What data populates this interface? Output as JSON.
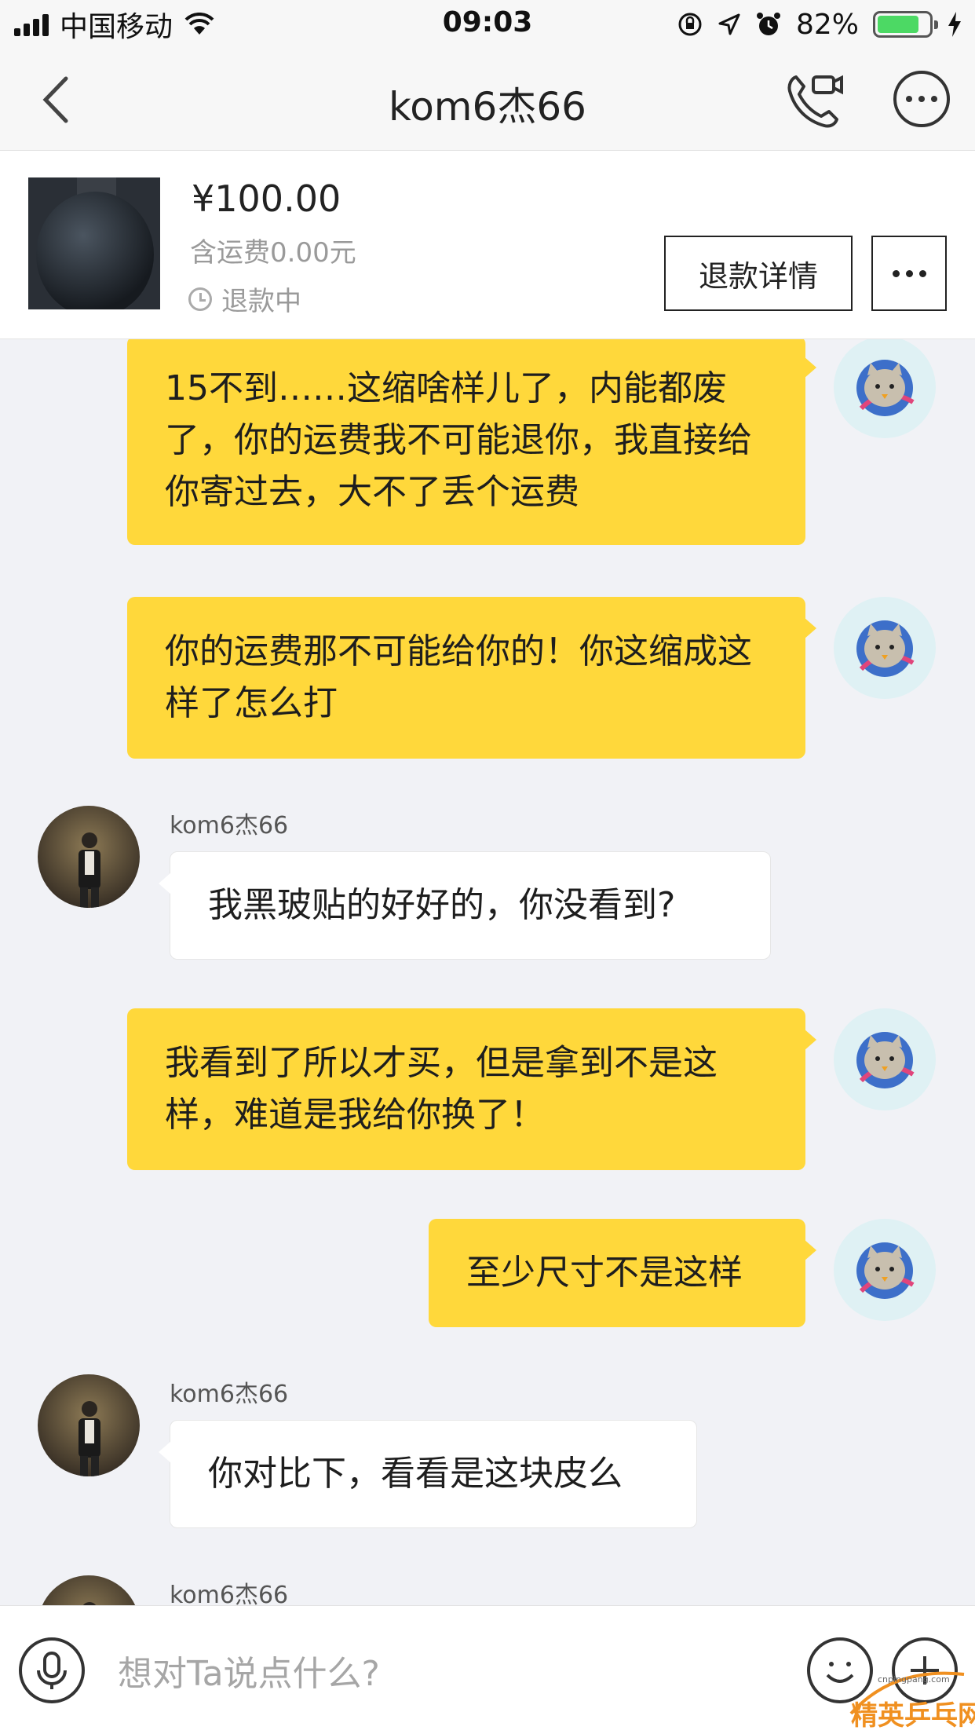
{
  "status_bar": {
    "carrier": "中国移动",
    "time": "09:03",
    "battery": "82%",
    "battery_level": 0.82
  },
  "nav": {
    "title": "kom6杰66"
  },
  "order": {
    "price": "¥100.00",
    "shipping": "含运费0.00元",
    "status": "退款中",
    "refund_button": "退款详情"
  },
  "messages": [
    {
      "from": "me",
      "text": "15不到……这缩啥样儿了，内能都废了，你的运费我不可能退你，我直接给你寄过去，大不了丢个运费"
    },
    {
      "from": "me",
      "text": "你的运费那不可能给你的！你这缩成这样了怎么打"
    },
    {
      "from": "them",
      "sender": "kom6杰66",
      "text": "我黑玻贴的好好的，你没看到?"
    },
    {
      "from": "me",
      "text": "我看到了所以才买，但是拿到不是这样，难道是我给你换了！"
    },
    {
      "from": "me",
      "text": "至少尺寸不是这样"
    },
    {
      "from": "them",
      "sender": "kom6杰66",
      "text": "你对比下，看看是这块皮么"
    },
    {
      "from": "them",
      "sender": "kom6杰66",
      "text": ""
    }
  ],
  "input": {
    "placeholder": "想对Ta说点什么?"
  },
  "watermark": {
    "main": "精英乒乓网",
    "site": "cnpingpang.com"
  },
  "colors": {
    "my_bubble": "#ffd83b",
    "their_bubble": "#ffffff",
    "background": "#f1f2f6",
    "battery": "#4cd964"
  }
}
